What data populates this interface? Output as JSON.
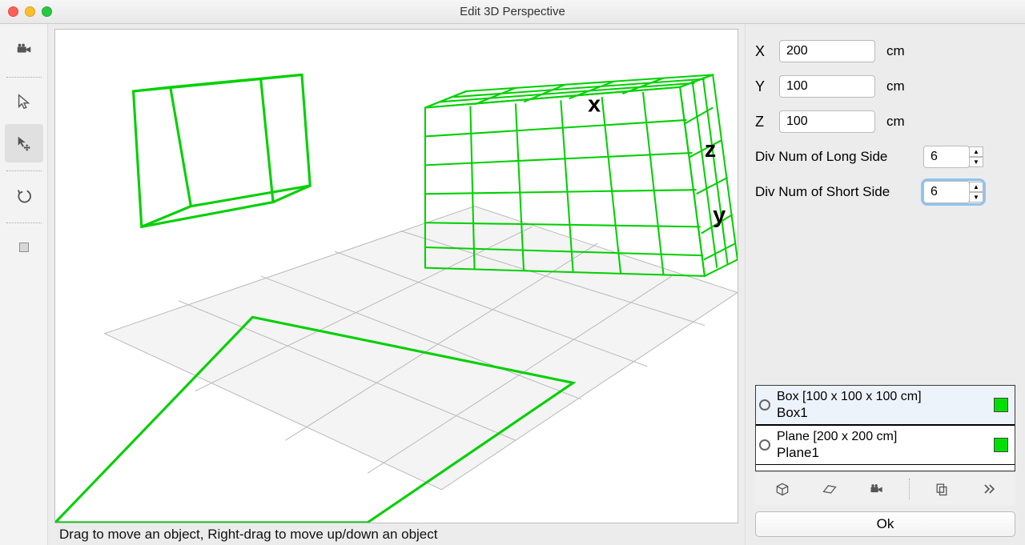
{
  "window": {
    "title": "Edit 3D Perspective"
  },
  "hint": "Drag to move an object, Right-drag to move up/down an object",
  "props": {
    "x_label": "X",
    "x_value": "200",
    "x_unit": "cm",
    "y_label": "Y",
    "y_value": "100",
    "y_unit": "cm",
    "z_label": "Z",
    "z_value": "100",
    "z_unit": "cm",
    "divlong_label": "Div Num of Long Side",
    "divlong_value": "6",
    "divshort_label": "Div Num of Short Side",
    "divshort_value": "6"
  },
  "axes": {
    "x": "x",
    "y": "y",
    "z": "z"
  },
  "objects": [
    {
      "type": "Box [100 x 100 x 100 cm]",
      "name": "Box1",
      "color": "#00e000",
      "selected": true
    },
    {
      "type": "Plane [200 x 200 cm]",
      "name": "Plane1",
      "color": "#00e000",
      "selected": false
    }
  ],
  "buttons": {
    "ok": "Ok"
  }
}
